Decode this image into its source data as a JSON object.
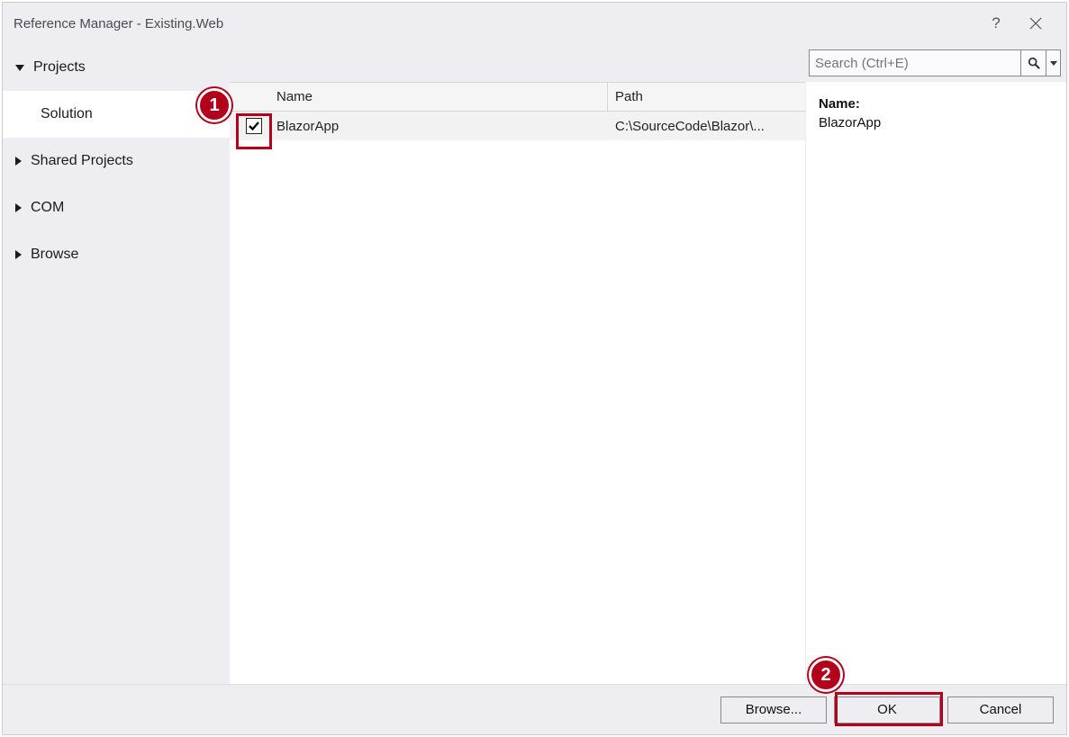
{
  "title": "Reference Manager - Existing.Web",
  "titlebar": {
    "help": "?",
    "close": "×"
  },
  "sidebar": {
    "items": [
      {
        "label": "Projects",
        "expanded": true
      },
      {
        "label": "Solution",
        "selected": true
      },
      {
        "label": "Shared Projects",
        "expanded": false
      },
      {
        "label": "COM",
        "expanded": false
      },
      {
        "label": "Browse",
        "expanded": false
      }
    ]
  },
  "search": {
    "placeholder": "Search (Ctrl+E)"
  },
  "columns": {
    "name": "Name",
    "path": "Path"
  },
  "rows": [
    {
      "checked": true,
      "name": "BlazorApp",
      "path": "C:\\SourceCode\\Blazor\\..."
    }
  ],
  "details": {
    "nameLabel": "Name:",
    "nameValue": "BlazorApp"
  },
  "footer": {
    "browse": "Browse...",
    "ok": "OK",
    "cancel": "Cancel"
  },
  "annotations": {
    "one": "1",
    "two": "2"
  }
}
